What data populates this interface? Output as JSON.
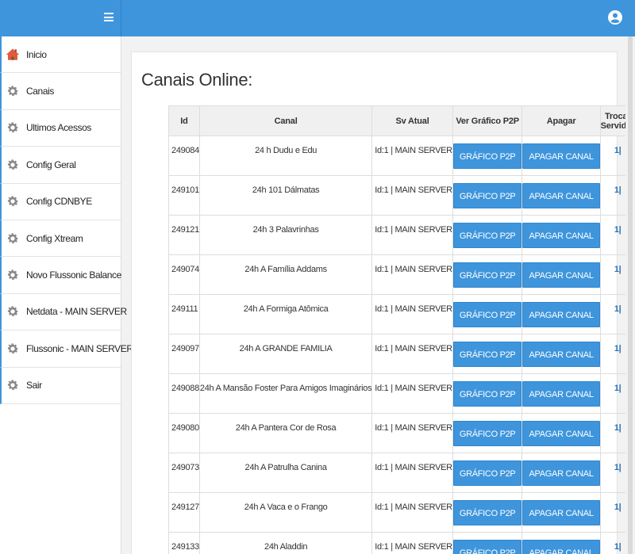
{
  "topbar": {
    "menu_icon": "hamburger-icon",
    "user_icon": "user-circle-icon",
    "color": "#3e95dc"
  },
  "sidebar": {
    "items": [
      {
        "label": "Inicio",
        "icon": "home-icon"
      },
      {
        "label": "Canais",
        "icon": "gear-icon"
      },
      {
        "label": "Ultimos Acessos",
        "icon": "gear-icon"
      },
      {
        "label": "Config Geral",
        "icon": "gear-icon"
      },
      {
        "label": "Config CDNBYE",
        "icon": "gear-icon"
      },
      {
        "label": "Config Xtream",
        "icon": "gear-icon"
      },
      {
        "label": "Novo Flussonic Balance",
        "icon": "gear-icon"
      },
      {
        "label": "Netdata - MAIN SERVER",
        "icon": "gear-icon"
      },
      {
        "label": "Flussonic - MAIN SERVER",
        "icon": "gear-icon"
      },
      {
        "label": "Sair",
        "icon": "gear-icon"
      }
    ]
  },
  "main": {
    "title": "Canais Online:",
    "table": {
      "columns": [
        "Id",
        "Canal",
        "Sv Atual",
        "Ver Gráfico P2P",
        "Apagar",
        "Trocar Servidor"
      ],
      "chart_button": "GRÁFICO P2P",
      "delete_button": "APAGAR CANAL",
      "rows": [
        {
          "id": "249084",
          "canal": "24 h Dudu e Edu",
          "sv": "Id:1 | MAIN SERVER",
          "swap": "1|"
        },
        {
          "id": "249101",
          "canal": "24h 101 Dálmatas",
          "sv": "Id:1 | MAIN SERVER",
          "swap": "1|"
        },
        {
          "id": "249121",
          "canal": "24h 3 Palavrinhas",
          "sv": "Id:1 | MAIN SERVER",
          "swap": "1|"
        },
        {
          "id": "249074",
          "canal": "24h A Família Addams",
          "sv": "Id:1 | MAIN SERVER",
          "swap": "1|"
        },
        {
          "id": "249111",
          "canal": "24h A Formiga Atômica",
          "sv": "Id:1 | MAIN SERVER",
          "swap": "1|"
        },
        {
          "id": "249097",
          "canal": "24h A GRANDE FAMILIA",
          "sv": "Id:1 | MAIN SERVER",
          "swap": "1|"
        },
        {
          "id": "249088",
          "canal": "24h A Mansão Foster Para Amigos Imaginários",
          "sv": "Id:1 | MAIN SERVER",
          "swap": "1|"
        },
        {
          "id": "249080",
          "canal": "24h A Pantera Cor de Rosa",
          "sv": "Id:1 | MAIN SERVER",
          "swap": "1|"
        },
        {
          "id": "249073",
          "canal": "24h A Patrulha Canina",
          "sv": "Id:1 | MAIN SERVER",
          "swap": "1|"
        },
        {
          "id": "249127",
          "canal": "24h A Vaca e o Frango",
          "sv": "Id:1 | MAIN SERVER",
          "swap": "1|"
        },
        {
          "id": "249133",
          "canal": "24h Aladdin",
          "sv": "Id:1 | MAIN SERVER",
          "swap": "1|"
        }
      ]
    }
  }
}
